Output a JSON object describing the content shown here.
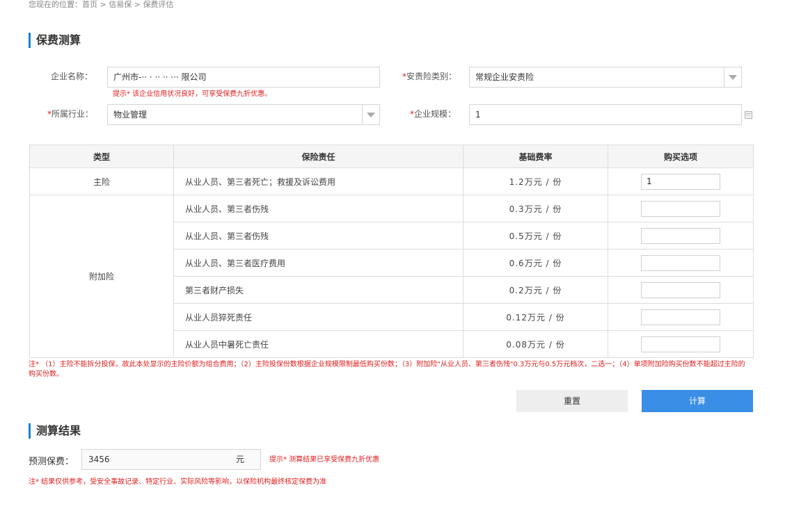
{
  "breadcrumb": {
    "prefix": "您现在的位置：",
    "items": [
      "首页",
      "信易保",
      "保费评估"
    ],
    "separator": " > "
  },
  "calc_section": {
    "title": "保费测算",
    "company": {
      "label": "企业名称：",
      "value": "广州市-·· · ·· ··   ··· 限公司"
    },
    "company_hint": "提示* 该企业信用状况良好，可享受保费九折优惠。",
    "insurance_type": {
      "label_required": "*",
      "label": "安责险类别：",
      "value": "常规企业安责险"
    },
    "industry": {
      "label_required": "*",
      "label": "所属行业：",
      "value": "物业管理"
    },
    "scale": {
      "label_required": "*",
      "label": "企业规模：",
      "value": "1"
    }
  },
  "table": {
    "headers": [
      "类型",
      "保险责任",
      "基础费率",
      "购买选项"
    ],
    "main": {
      "type": "主险",
      "desc": "从业人员、第三者死亡；救援及诉讼费用",
      "rate": "1.2万元 / 份",
      "qty": "1"
    },
    "addon_type": "附加险",
    "addons": [
      {
        "desc": "从业人员、第三者伤残",
        "rate": "0.3万元 / 份",
        "qty": ""
      },
      {
        "desc": "从业人员、第三者伤残",
        "rate": "0.5万元 / 份",
        "qty": ""
      },
      {
        "desc": "从业人员、第三者医疗费用",
        "rate": "0.6万元 / 份",
        "qty": ""
      },
      {
        "desc": "第三者财产损失",
        "rate": "0.2万元 / 份",
        "qty": ""
      },
      {
        "desc": "从业人员猝死责任",
        "rate": "0.12万元 / 份",
        "qty": ""
      },
      {
        "desc": "从业人员中暑死亡责任",
        "rate": "0.08万元 / 份",
        "qty": ""
      }
    ]
  },
  "note": "注* （1）主险不能拆分投保，故此本处显示的主险价额为组合费用；（2）主险投保份数根据企业规模限制最低购买份数；（3）附加险\"从业人员、第三者伤残\"0.3万元与0.5万元档次，二选一；（4）单项附加险购买份数不能超过主险的购买份数。",
  "buttons": {
    "reset": "重置",
    "calculate": "计算"
  },
  "result_section": {
    "title": "测算结果",
    "label": "预测保费：",
    "value": "3456",
    "unit": "元",
    "hint": "提示* 测算结果已享受保费九折优惠",
    "note": "注* 结果仅供参考，受安全事故记录、特定行业、实际风险等影响，以保险机构最终核定保费为准"
  },
  "colors": {
    "accent": "#1a7fd6",
    "primary_button": "#3a8ee6",
    "warning_text": "#e02020"
  }
}
